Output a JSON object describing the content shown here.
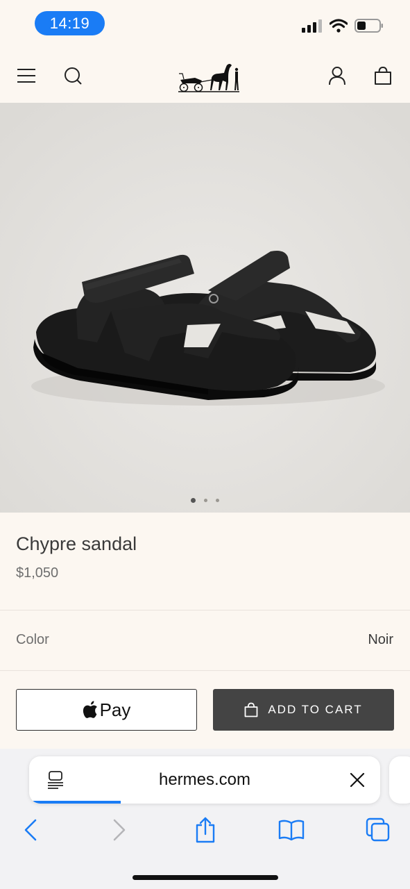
{
  "status_bar": {
    "time": "14:19"
  },
  "header": {
    "menu_icon": "hamburger-menu-icon",
    "search_icon": "search-icon",
    "logo": "hermes-carriage-logo",
    "account_icon": "account-icon",
    "bag_icon": "shopping-bag-icon"
  },
  "gallery": {
    "image": "black leather sandal product photo",
    "slides": 3,
    "active_slide": 1
  },
  "product": {
    "title": "Chypre sandal",
    "price": "$1,050"
  },
  "color": {
    "label": "Color",
    "value": "Noir"
  },
  "actions": {
    "apple_pay_label": "Pay",
    "add_to_cart_label": "ADD TO CART"
  },
  "browser": {
    "url": "hermes.com",
    "load_progress": 0.26
  },
  "colors": {
    "accent": "#1a7cf5",
    "background": "#fcf7f1",
    "button_dark": "#444444"
  }
}
